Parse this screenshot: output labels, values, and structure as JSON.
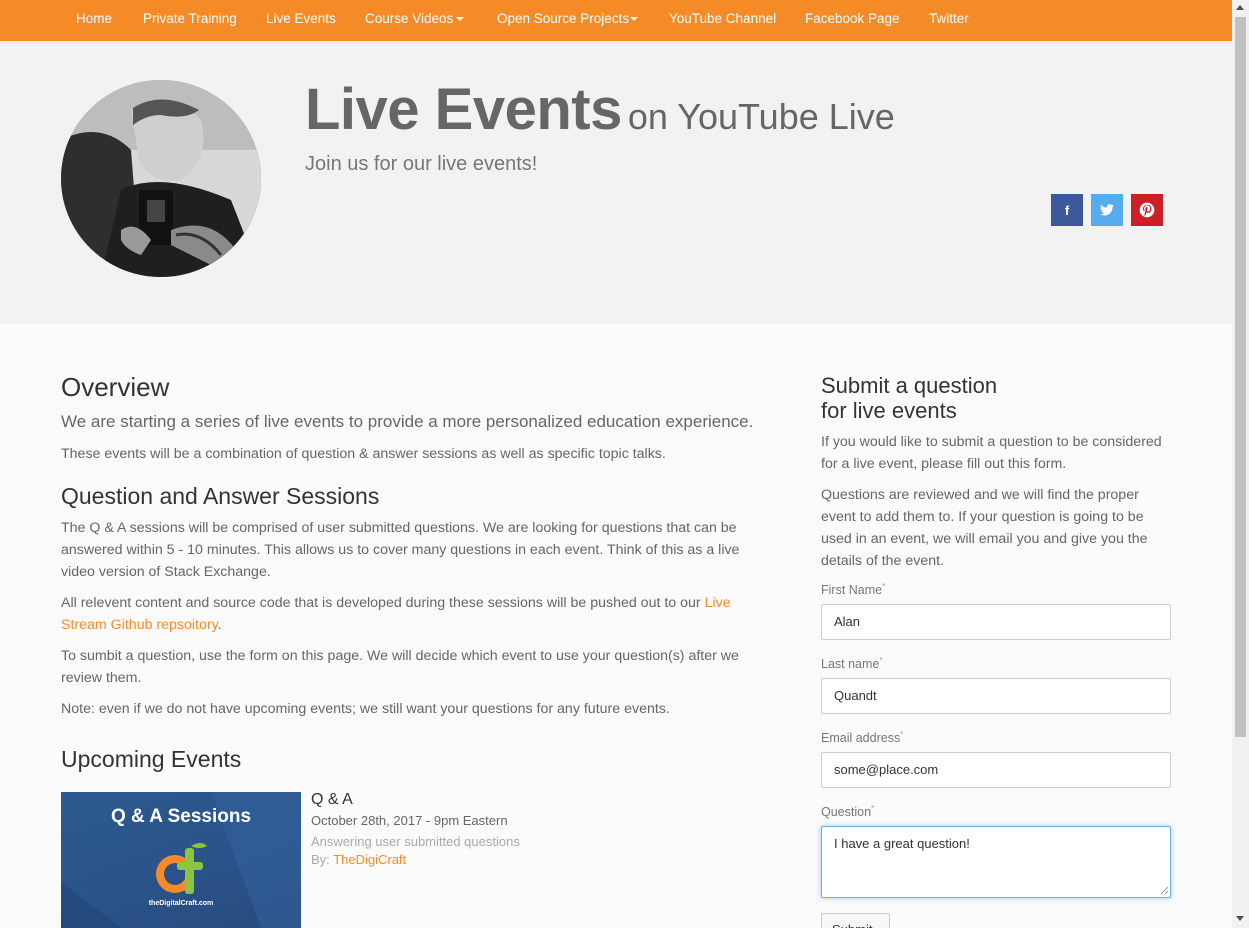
{
  "nav": {
    "items": [
      {
        "label": "Home"
      },
      {
        "label": "Private Training"
      },
      {
        "label": "Live Events"
      },
      {
        "label": "Course Videos"
      },
      {
        "label": "Open Source Projects"
      },
      {
        "label": "YouTube Channel"
      },
      {
        "label": "Facebook Page"
      },
      {
        "label": "Twitter"
      }
    ]
  },
  "hero": {
    "title": "Live Events",
    "title_suffix": "on YouTube Live",
    "subtitle": "Join us for our live events!",
    "share": [
      {
        "icon": "facebook-icon",
        "glyph": "f",
        "color": "#3b5998"
      },
      {
        "icon": "twitter-icon",
        "glyph": "t",
        "color": "#55acee"
      },
      {
        "icon": "pinterest-icon",
        "glyph": "P",
        "color": "#cb2027"
      }
    ]
  },
  "overview": {
    "heading": "Overview",
    "lead": "We are starting a series of live events to provide a more personalized education experience.",
    "text": "These events will be a combination of question & answer sessions as well as specific topic talks."
  },
  "qa": {
    "heading": "Question and Answer Sessions",
    "p1": "The Q & A sessions will be comprised of user submitted questions. We are looking for questions that can be answered within 5 - 10 minutes. This allows us to cover many questions in each event. Think of this as a live video version of Stack Exchange.",
    "p2_before": "All relevent content and source code that is developed during these sessions will be pushed out to our ",
    "p2_link": "Live Stream Github repsoitory",
    "p2_after": ".",
    "p3": "To sumbit a question, use the form on this page. We will decide which event to use your question(s) after we review them.",
    "p4": "Note: even if we do not have upcoming events; we still want your questions for any future events."
  },
  "upcoming": {
    "heading": "Upcoming Events",
    "event": {
      "thumb_title": "Q & A Sessions",
      "thumb_logo": "dt",
      "thumb_site": "theDigitalCraft.com",
      "title": "Q & A",
      "date": "October 28th, 2017 - 9pm Eastern",
      "description": "Answering user submitted questions",
      "by_label": "By:",
      "by_author": "TheDigiCraft"
    }
  },
  "form": {
    "heading_line1": "Submit a question",
    "heading_line2": "for live events",
    "intro1": "If you would like to submit a question to be considered for a live event, please fill out this form.",
    "intro2": "Questions are reviewed and we will find the proper event to add them to. If your question is going to be used in an event, we will email you and give you the details of the event.",
    "required_mark": "*",
    "first_name": {
      "label": "First Name",
      "value": "Alan"
    },
    "last_name": {
      "label": "Last name",
      "value": "Quandt"
    },
    "email": {
      "label": "Email address",
      "value": "some@place.com"
    },
    "question": {
      "label": "Question",
      "value": "I have a great question!"
    },
    "submit_label": "Submit"
  }
}
